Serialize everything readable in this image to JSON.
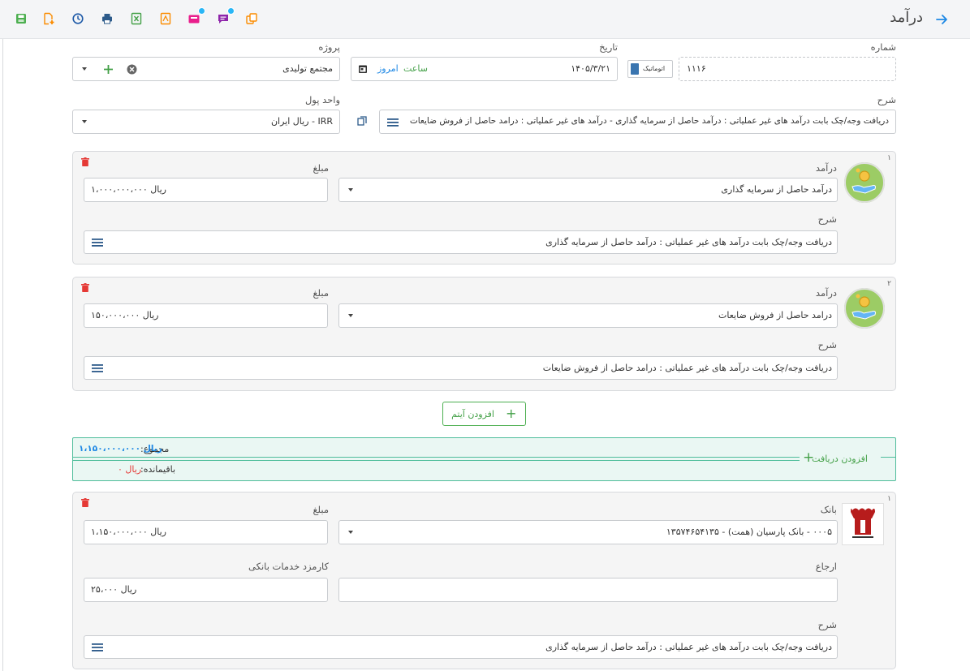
{
  "header": {
    "title": "درآمد"
  },
  "toolbar": {
    "icons": [
      "save-icon",
      "new-document-icon",
      "history-icon",
      "print-icon",
      "excel-export-icon",
      "pdf-export-icon",
      "inbox-icon",
      "comments-icon",
      "copy-icon"
    ]
  },
  "form": {
    "number_label": "شماره",
    "number_value": "۱۱۱۶",
    "auto_label": "اتوماتیک",
    "date_label": "تاریخ",
    "date_value": "۱۴۰۵/۳/۲۱",
    "time_link": "ساعت",
    "today_link": "امروز",
    "project_label": "پروژه",
    "project_value": "مجتمع تولیدی",
    "description_label": "شرح",
    "description_value": "دریافت وجه/چک بابت درآمد های غیر عملیاتی : درآمد حاصل از سرمایه گذاری - درآمد های غیر عملیاتی : درامد حاصل از فروش ضایعات",
    "currency_label": "واحد پول",
    "currency_value": "IRR - ریال ایران"
  },
  "items": [
    {
      "num": "۱",
      "income_label": "درآمد",
      "income_value": "درآمد حاصل از سرمایه گذاری",
      "amount_label": "مبلغ",
      "amount_value": "ریال ۱،۰۰۰،۰۰۰،۰۰۰",
      "desc_label": "شرح",
      "desc_value": "دریافت وجه/چک بابت درآمد های غیر عملیاتی : درآمد حاصل از سرمایه گذاری"
    },
    {
      "num": "۲",
      "income_label": "درآمد",
      "income_value": "درامد حاصل از فروش ضایعات",
      "amount_label": "مبلغ",
      "amount_value": "ریال ۱۵۰،۰۰۰،۰۰۰",
      "desc_label": "شرح",
      "desc_value": "دریافت وجه/چک بابت درآمد های غیر عملیاتی : درامد حاصل از فروش ضایعات"
    }
  ],
  "add_item_label": "افزودن آیتم",
  "summary": {
    "add_receipt_label": "افزودن دریافت",
    "total_label": "مجموع:",
    "total_value": "ریال ۱،۱۵۰،۰۰۰،۰۰۰",
    "remaining_label": "باقیمانده:",
    "remaining_value": "ریال ۰"
  },
  "receipt": {
    "num": "۱",
    "bank_label": "بانک",
    "bank_value": "۰۰۰۵ - بانک پارسیان (همت) - ۱۳۵۷۴۶۵۴۱۳۵",
    "amount_label": "مبلغ",
    "amount_value": "ریال ۱،۱۵۰،۰۰۰،۰۰۰",
    "reference_label": "ارجاع",
    "reference_value": "",
    "fee_label": "کارمزد خدمات بانکی",
    "fee_value": "ریال ۲۵،۰۰۰",
    "desc_label": "شرح",
    "desc_value": "دریافت وجه/چک بابت درآمد های غیر عملیاتی : درآمد حاصل از سرمایه گذاری"
  },
  "colors": {
    "accent_green": "#4caf50",
    "delete_red": "#e53935",
    "link_blue": "#1e88e5",
    "summary_bg": "#eaf7f3"
  }
}
